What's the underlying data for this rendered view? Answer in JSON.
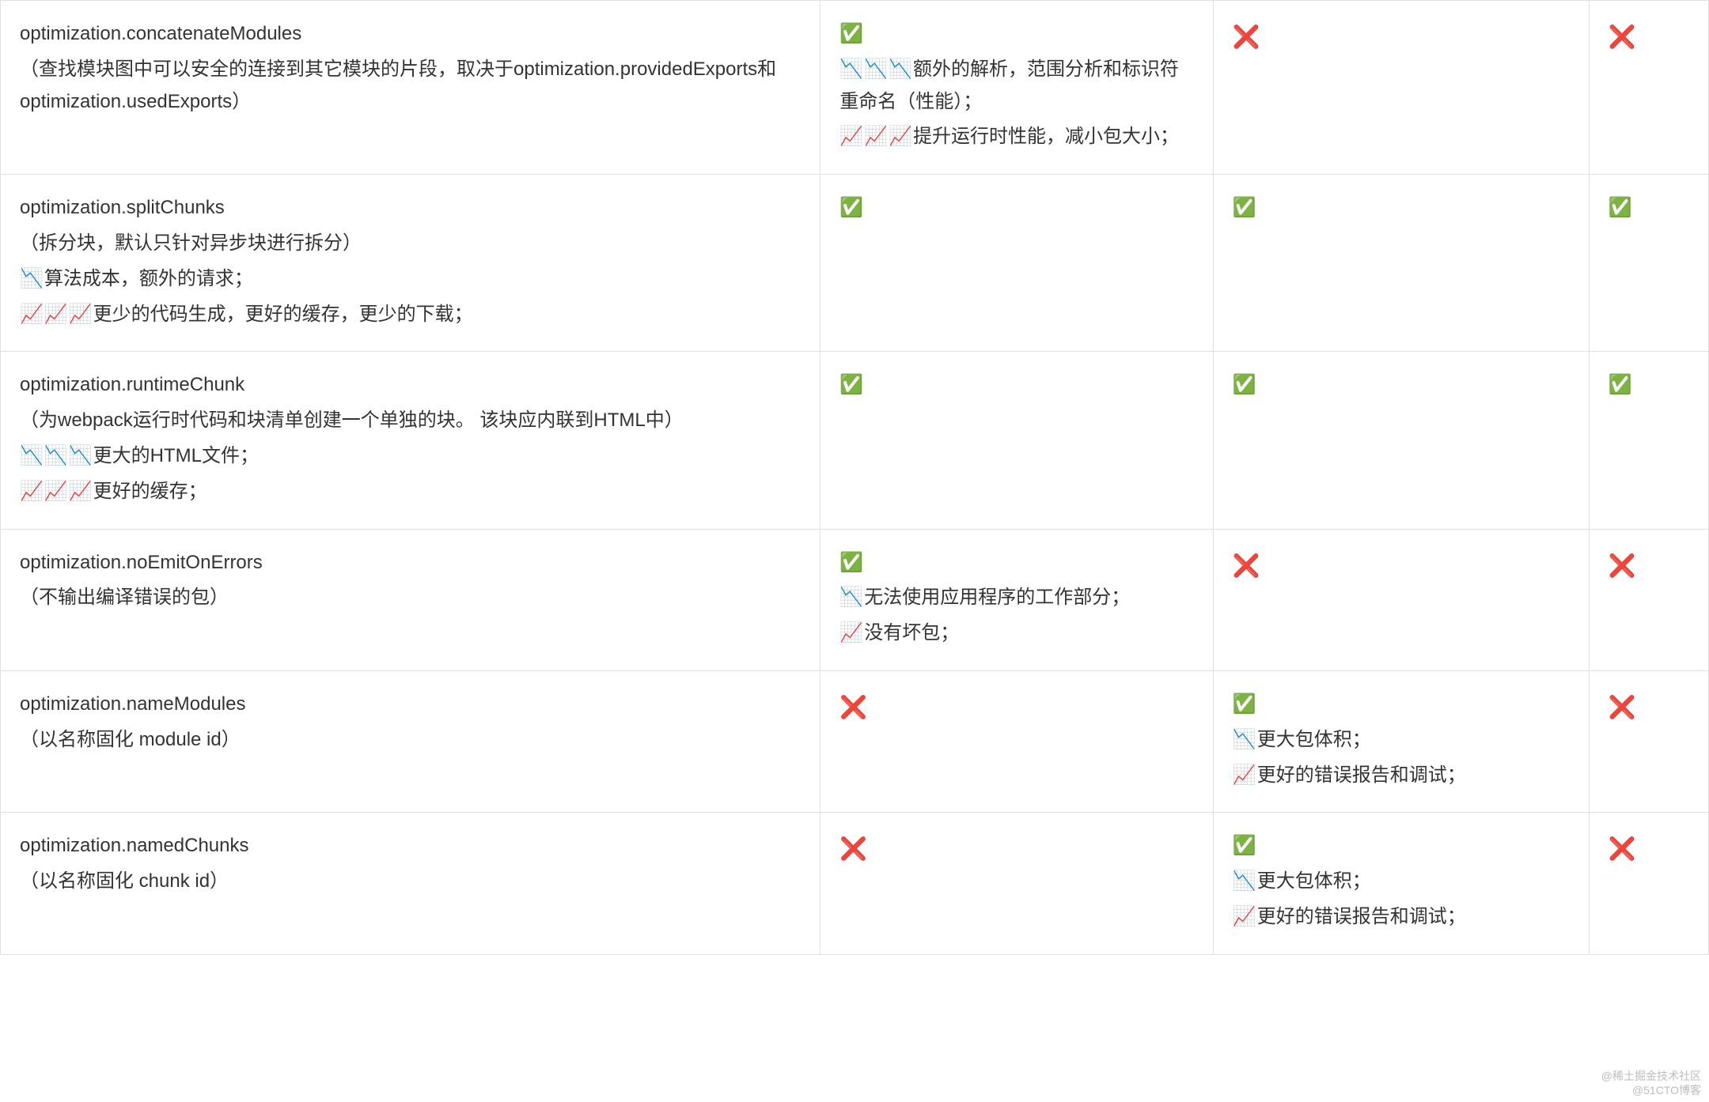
{
  "icons": {
    "check": "✅",
    "cross": "❌",
    "down3": "📉📉📉",
    "down1": "📉",
    "up3": "📈📈📈",
    "up1": "📈"
  },
  "rows": [
    {
      "c1": {
        "title": "optimization.concatenateModules",
        "desc": "（查找模块图中可以安全的连接到其它模块的片段，取决于optimization.providedExports和optimization.usedExports）"
      },
      "c2": {
        "status": "check",
        "lines": [
          {
            "emoji": "down3",
            "text": "额外的解析，范围分析和标识符重命名（性能）；"
          },
          {
            "emoji": "up3",
            "text": "提升运行时性能，减小包大小；"
          }
        ]
      },
      "c3": {
        "status": "cross"
      },
      "c4": {
        "status": "cross"
      }
    },
    {
      "c1": {
        "title": "optimization.splitChunks",
        "desc": "（拆分块，默认只针对异步块进行拆分）",
        "extra": [
          {
            "emoji": "down1",
            "text": "算法成本，额外的请求；"
          },
          {
            "emoji": "up3",
            "text": "更少的代码生成，更好的缓存，更少的下载；"
          }
        ]
      },
      "c2": {
        "status": "check"
      },
      "c3": {
        "status": "check"
      },
      "c4": {
        "status": "check"
      }
    },
    {
      "c1": {
        "title": "optimization.runtimeChunk",
        "desc": "（为webpack运行时代码和块清单创建一个单独的块。 该块应内联到HTML中）",
        "extra": [
          {
            "emoji": "down3",
            "text": "更大的HTML文件；"
          },
          {
            "emoji": "up3",
            "text": "更好的缓存；"
          }
        ]
      },
      "c2": {
        "status": "check"
      },
      "c3": {
        "status": "check"
      },
      "c4": {
        "status": "check"
      }
    },
    {
      "c1": {
        "title": "optimization.noEmitOnErrors",
        "desc": "（不输出编译错误的包）"
      },
      "c2": {
        "status": "check",
        "lines": [
          {
            "emoji": "down1",
            "text": "无法使用应用程序的工作部分；"
          },
          {
            "emoji": "up1",
            "text": "没有坏包；"
          }
        ]
      },
      "c3": {
        "status": "cross"
      },
      "c4": {
        "status": "cross"
      }
    },
    {
      "c1": {
        "title": "optimization.nameModules",
        "desc": "（以名称固化 module id）"
      },
      "c2": {
        "status": "cross"
      },
      "c3": {
        "status": "check",
        "lines": [
          {
            "emoji": "down1",
            "text": "更大包体积；"
          },
          {
            "emoji": "up1",
            "text": "更好的错误报告和调试；"
          }
        ]
      },
      "c4": {
        "status": "cross"
      }
    },
    {
      "c1": {
        "title": "optimization.namedChunks",
        "desc": "（以名称固化 chunk id）"
      },
      "c2": {
        "status": "cross"
      },
      "c3": {
        "status": "check",
        "lines": [
          {
            "emoji": "down1",
            "text": "更大包体积；"
          },
          {
            "emoji": "up1",
            "text": "更好的错误报告和调试；"
          }
        ]
      },
      "c4": {
        "status": "cross"
      }
    }
  ],
  "watermarks": {
    "br1": "@稀土掘金技术社区",
    "br2": "@51CTO博客",
    "blc": ""
  }
}
